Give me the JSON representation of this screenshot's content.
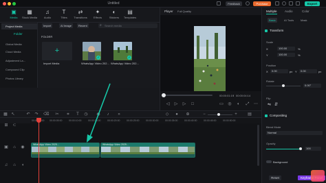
{
  "window": {
    "title": "Untitled",
    "feedback": "Feedback",
    "purchase": "Purchase",
    "export": "Export"
  },
  "toolbar": {
    "items": [
      {
        "label": "Media",
        "icon": "media-icon"
      },
      {
        "label": "Stock Media",
        "icon": "stock-media-icon"
      },
      {
        "label": "Audio",
        "icon": "audio-icon"
      },
      {
        "label": "Titles",
        "icon": "titles-icon"
      },
      {
        "label": "Transitions",
        "icon": "transitions-icon"
      },
      {
        "label": "Effects",
        "icon": "effects-icon"
      },
      {
        "label": "Stickers",
        "icon": "stickers-icon"
      },
      {
        "label": "Templates",
        "icon": "templates-icon"
      }
    ]
  },
  "media_sidebar": {
    "project_media": "Project Media",
    "folder": "Folder",
    "items": [
      "Global Media",
      "Cloud Media",
      "Adjustment La...",
      "Compound Clip",
      "Photos Library"
    ]
  },
  "media_panel": {
    "import": "Import",
    "ai_image": "AI Image",
    "recent": "Recent",
    "search_placeholder": "Search media",
    "folder_label": "FOLDER",
    "tiles": [
      {
        "label": "Import Media"
      },
      {
        "label": "WhatsApp Video 202..."
      },
      {
        "label": "WhatsApp Video 202..."
      }
    ]
  },
  "player": {
    "label": "Player",
    "quality": "Full Quality",
    "time_current": "00:00:01:19",
    "time_total": "00:00:04:14"
  },
  "properties": {
    "tabs": [
      "Multiple",
      "Audio",
      "Color"
    ],
    "subtabs": [
      "Basic",
      "AI Tools",
      "Mask"
    ],
    "transform": "Transform",
    "scale_label": "Scale",
    "scale_x_label": "X",
    "scale_x": "100.00",
    "scale_x_unit": "%",
    "scale_y_label": "Y",
    "scale_y": "100.00",
    "scale_y_unit": "%",
    "position_label": "Position",
    "pos_x_label": "X",
    "pos_x": "0.00",
    "pos_x_unit": "px",
    "pos_y_label": "Y",
    "pos_y": "0.00",
    "pos_y_unit": "px",
    "rotate_label": "Rotate",
    "rotate": "0.00°",
    "flip_label": "Flip",
    "compositing": "Compositing",
    "blend_label": "Blend Mode",
    "blend_value": "Normal",
    "opacity_label": "Opacity",
    "opacity_value": "100",
    "background": "Background",
    "reset": "Reset",
    "keyframe": "Keyframe Panel"
  },
  "timeline": {
    "ticks": [
      "00:00:00:00",
      "00:00:05:00",
      "00:00:10:00",
      "00:00:15:00",
      "00:00:20:00",
      "00:00:25:00",
      "00:00:30:00",
      "00:00:35:00",
      "00:00:40:00",
      "00:00:45:00",
      "00:00:50:00"
    ],
    "clip1_label": "WhatsApp Video 2025...",
    "clip2_label": "WhatsApp Video 2025..."
  },
  "colors": {
    "accent": "#16c7a8",
    "purchase": "#e86a2e",
    "playhead": "#e8413b",
    "keyframe": "#7a3be8",
    "arrow": "#16c7a8"
  }
}
